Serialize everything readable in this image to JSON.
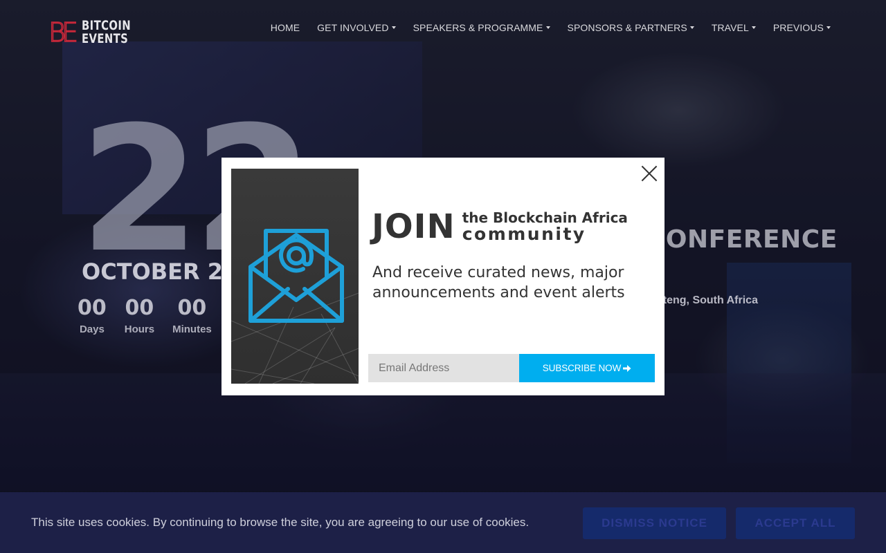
{
  "brand": {
    "logo_mark": [
      "B",
      "E"
    ],
    "logo_line1": "BITCOIN",
    "logo_line2": "EVENTS",
    "accent_color": "#c8283a"
  },
  "nav": {
    "items": [
      {
        "label": "HOME",
        "has_dropdown": false
      },
      {
        "label": "GET INVOLVED",
        "has_dropdown": true
      },
      {
        "label": "SPEAKERS & PROGRAMME",
        "has_dropdown": true
      },
      {
        "label": "SPONSORS & PARTNERS",
        "has_dropdown": true
      },
      {
        "label": "TRAVEL",
        "has_dropdown": true
      },
      {
        "label": "PREVIOUS",
        "has_dropdown": true
      }
    ]
  },
  "hero": {
    "day": "22",
    "month": "OCTOBER 2",
    "countdown": [
      {
        "value": "00",
        "label": "Days"
      },
      {
        "value": "00",
        "label": "Hours"
      },
      {
        "value": "00",
        "label": "Minutes"
      }
    ],
    "title_fragment": "CONFERENCE",
    "location_fragment": "uteng, South Africa"
  },
  "modal": {
    "join_word": "JOIN",
    "join_line1": "the Blockchain Africa",
    "join_line2": "community",
    "description": "And receive curated news, major announcements and event alerts",
    "email_placeholder": "Email Address",
    "subscribe_label": "SUBSCRIBE NOW",
    "subscribe_color": "#00aeef",
    "icon": "envelope-at-icon"
  },
  "cookie": {
    "message": "This site uses cookies. By continuing to browse the site, you are agreeing to our use of cookies.",
    "dismiss_label": "DISMISS NOTICE",
    "accept_label": "ACCEPT ALL"
  }
}
